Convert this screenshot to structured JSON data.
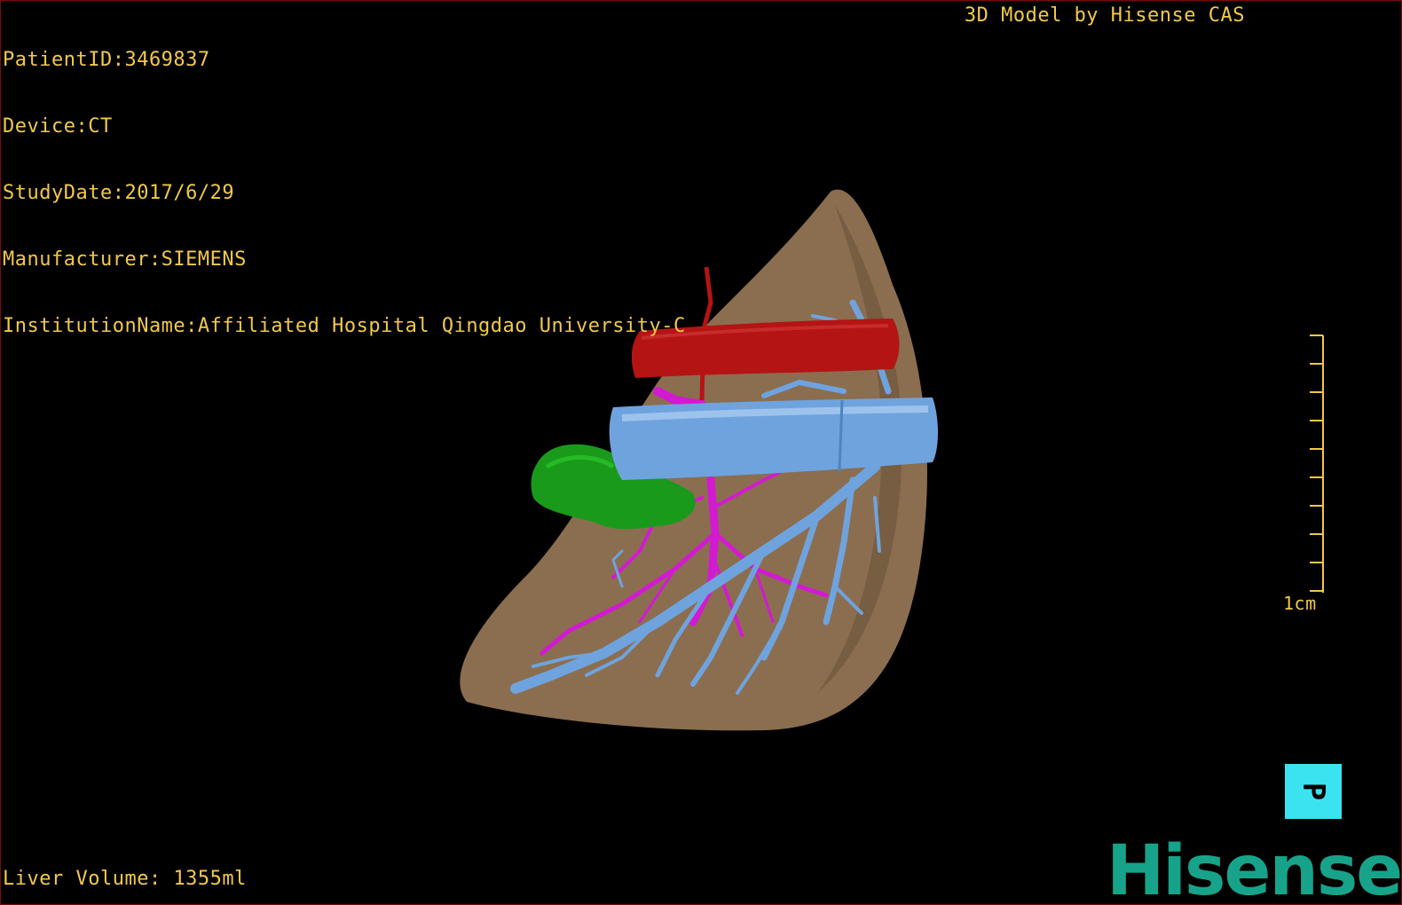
{
  "header": {
    "patient_id": "PatientID:3469837",
    "device": "Device:CT",
    "study_date": "StudyDate:2017/6/29",
    "manufacturer": "Manufacturer:SIEMENS",
    "institution": "InstitutionName:Affiliated Hospital Qingdao University-C",
    "model_by": "3D Model by Hisense CAS"
  },
  "footer": {
    "liver_volume": "Liver Volume: 1355ml"
  },
  "scale_bar": {
    "label": "1cm"
  },
  "orientation": {
    "label": "P"
  },
  "brand": {
    "logo_text": "Hisense"
  },
  "colors": {
    "overlay_text": "#f2c94a",
    "liver": "#8b6e4f",
    "portal_vein": "#6fa3de",
    "artery": "#b51414",
    "hepatic_vein": "#d21ad2",
    "gallbladder": "#1a9a1a",
    "orientation_bg": "#3be2f0",
    "logo": "#17a38a"
  }
}
